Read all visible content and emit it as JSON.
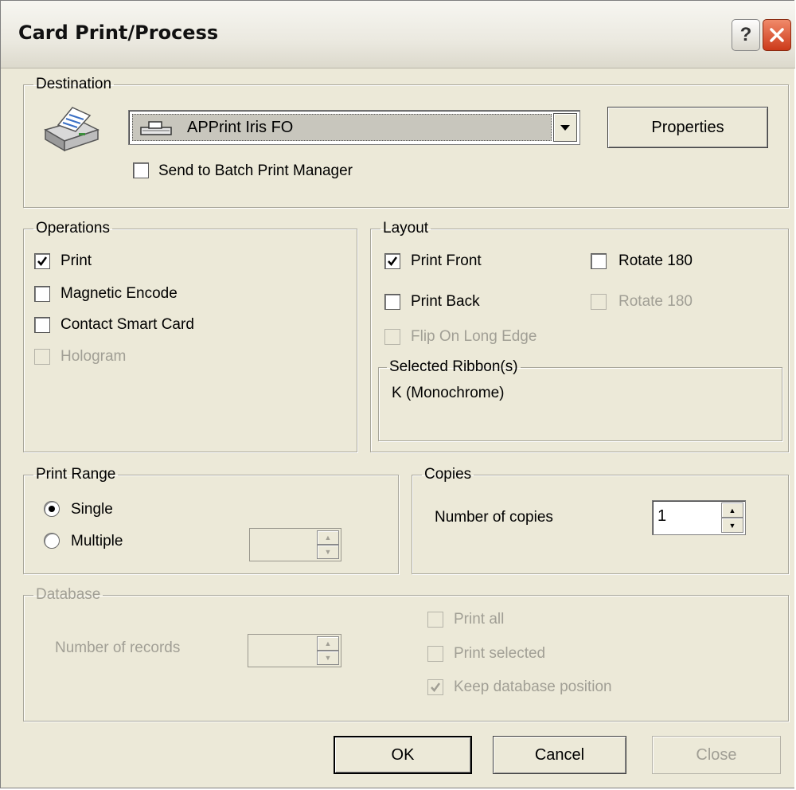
{
  "title": "Card Print/Process",
  "destination": {
    "legend": "Destination",
    "printer": "APPrint Iris FO",
    "properties_label": "Properties",
    "batch_label": "Send to Batch Print Manager",
    "batch_checked": false
  },
  "operations": {
    "legend": "Operations",
    "items": [
      {
        "label": "Print",
        "checked": true,
        "enabled": true
      },
      {
        "label": "Magnetic Encode",
        "checked": false,
        "enabled": true
      },
      {
        "label": "Contact Smart Card",
        "checked": false,
        "enabled": true
      },
      {
        "label": "Hologram",
        "checked": false,
        "enabled": false
      }
    ]
  },
  "layout": {
    "legend": "Layout",
    "print_front": "Print Front",
    "print_front_checked": true,
    "rotate_front": "Rotate 180",
    "print_back": "Print Back",
    "rotate_back": "Rotate 180",
    "flip": "Flip On Long Edge",
    "ribbon_legend": "Selected Ribbon(s)",
    "ribbon_value": "K (Monochrome)"
  },
  "print_range": {
    "legend": "Print Range",
    "single": "Single",
    "multiple": "Multiple",
    "selected": "Single"
  },
  "copies": {
    "legend": "Copies",
    "label": "Number of copies",
    "value": "1"
  },
  "database": {
    "legend": "Database",
    "records_label": "Number of records",
    "print_all": "Print all",
    "print_selected": "Print selected",
    "keep_position": "Keep database position",
    "keep_position_checked": true
  },
  "buttons": {
    "ok": "OK",
    "cancel": "Cancel",
    "close": "Close"
  }
}
